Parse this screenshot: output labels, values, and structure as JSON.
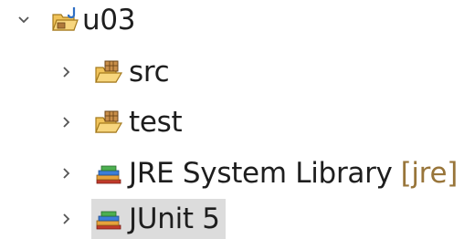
{
  "tree": {
    "project": {
      "label": "u03",
      "expanded": true,
      "icon": "java-project-folder-icon"
    },
    "children": [
      {
        "label": "src",
        "icon": "source-folder-icon",
        "expanded": false
      },
      {
        "label": "test",
        "icon": "source-folder-icon",
        "expanded": false
      },
      {
        "label": "JRE System Library",
        "decoration": "[jre]",
        "icon": "library-icon",
        "expanded": false
      },
      {
        "label": "JUnit 5",
        "icon": "library-icon",
        "expanded": false,
        "selected": true
      }
    ]
  },
  "colors": {
    "selection": "#dcdcdc",
    "decoration": "#98753a",
    "folder": "#e8b84a",
    "package": "#8a5a2b",
    "library_books": [
      "#c0392b",
      "#e6a23c",
      "#3b7dd8"
    ]
  }
}
